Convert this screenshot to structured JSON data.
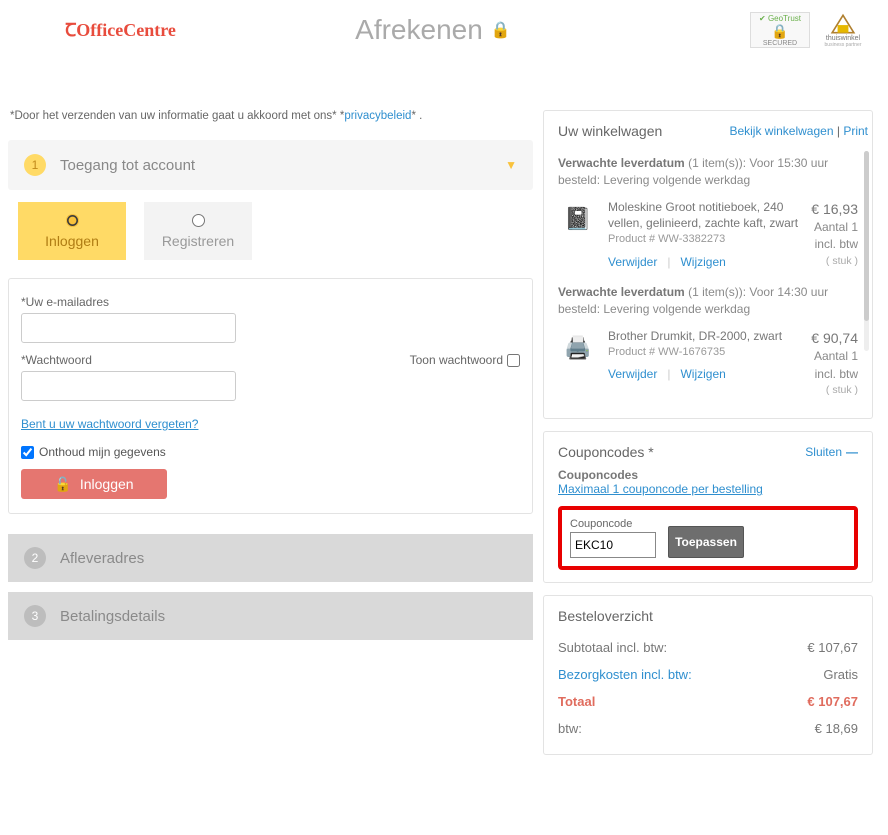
{
  "header": {
    "logo": "OfficeCentre",
    "title": "Afrekenen",
    "badge_secured": "SECURED",
    "badge_geotrust": "GeoTrust",
    "badge_thuiswinkel": "thuiswinkel",
    "badge_thuiswinkel_sub": "business partner"
  },
  "consent": {
    "text": "*Door het verzenden van uw informatie gaat u akkoord met ons* *",
    "link": "privacybeleid",
    "suffix": "* ."
  },
  "steps": {
    "s1": {
      "num": "1",
      "label": "Toegang tot account"
    },
    "s2": {
      "num": "2",
      "label": "Afleveradres"
    },
    "s3": {
      "num": "3",
      "label": "Betalingsdetails"
    }
  },
  "tabs": {
    "login": "Inloggen",
    "register": "Registreren"
  },
  "login": {
    "email_label": "*Uw e-mailadres",
    "password_label": "*Wachtwoord",
    "show_password": "Toon wachtwoord",
    "forgot": "Bent u uw wachtwoord vergeten?",
    "remember": "Onthoud mijn gegevens",
    "button": "Inloggen"
  },
  "cart": {
    "title": "Uw winkelwagen",
    "link_view": "Bekijk winkelwagen",
    "link_print": "Print",
    "delivery_label": "Verwachte leverdatum",
    "groups": [
      {
        "note": "(1 item(s)): Voor 15:30 uur besteld: Levering volgende werkdag",
        "item": {
          "name": "Moleskine Groot notitieboek, 240 vellen, gelinieerd, zachte kaft, zwart",
          "pn": "Product # WW-3382273",
          "price": "€ 16,93",
          "qty": "Aantal 1",
          "vat": "incl. btw",
          "unit": "( stuk )"
        }
      },
      {
        "note": "(1 item(s)): Voor 14:30 uur besteld: Levering volgende werkdag",
        "item": {
          "name": "Brother Drumkit, DR-2000, zwart",
          "pn": "Product # WW-1676735",
          "price": "€ 90,74",
          "qty": "Aantal 1",
          "vat": "incl. btw",
          "unit": "( stuk )"
        }
      }
    ],
    "remove": "Verwijder",
    "edit": "Wijzigen"
  },
  "coupon": {
    "title": "Couponcodes *",
    "close": "Sluiten",
    "label": "Couponcodes",
    "info_link": "Maximaal 1 couponcode per bestelling",
    "field_label": "Couponcode",
    "value": "EKC10",
    "apply": "Toepassen"
  },
  "summary": {
    "title": "Besteloverzicht",
    "rows": {
      "subtotal_label": "Subtotaal incl. btw:",
      "subtotal_val": "€ 107,67",
      "shipping_label": "Bezorgkosten incl. btw:",
      "shipping_val": "Gratis",
      "total_label": "Totaal",
      "total_val": "€ 107,67",
      "vat_label": "btw:",
      "vat_val": "€ 18,69"
    }
  }
}
